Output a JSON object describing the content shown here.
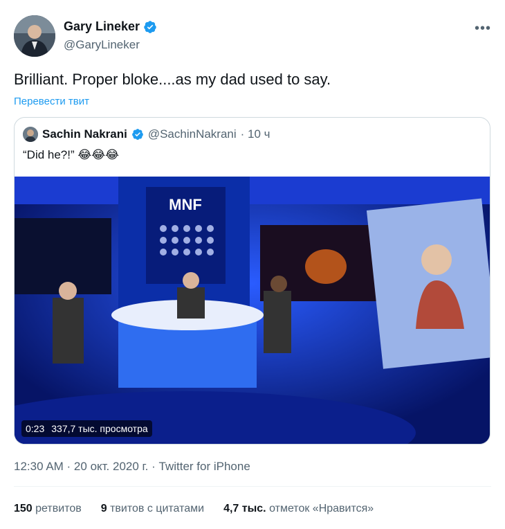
{
  "author": {
    "name": "Gary Lineker",
    "handle": "@GaryLineker"
  },
  "tweet": {
    "text": "Brilliant. Proper bloke....as my dad used to say.",
    "translate_label": "Перевести твит"
  },
  "quoted": {
    "name": "Sachin Nakrani",
    "handle": "@SachinNakrani",
    "time": "· 10 ч",
    "text": "“Did he?!” 😂😂😂",
    "video": {
      "duration": "0:23",
      "views": "337,7 тыс. просмотра",
      "logo": "MNF"
    }
  },
  "timestamp": {
    "time": "12:30 AM · 20 окт. 2020 г. · ",
    "source": "Twitter for iPhone"
  },
  "stats": {
    "retweets_count": "150",
    "retweets_label": "ретвитов",
    "quotes_count": "9",
    "quotes_label": "твитов с цитатами",
    "likes_count": "4,7 тыс.",
    "likes_label": "отметок «Нравится»"
  },
  "colors": {
    "verified": "#1d9bf0",
    "link": "#1d9bf0"
  }
}
